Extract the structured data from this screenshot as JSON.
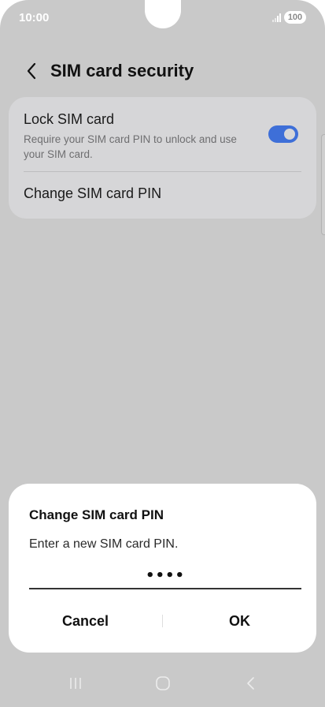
{
  "status_bar": {
    "time": "10:00",
    "battery": "100"
  },
  "header": {
    "title": "SIM card security",
    "back_icon": "chevron-left-icon"
  },
  "settings": {
    "lock_sim": {
      "title": "Lock SIM card",
      "description": "Require your SIM card PIN to unlock and use your SIM card.",
      "toggle_on": true
    },
    "change_pin": {
      "label": "Change SIM card PIN"
    }
  },
  "dialog": {
    "title": "Change SIM card PIN",
    "message": "Enter a new SIM card PIN.",
    "pin_value": "••••",
    "cancel_label": "Cancel",
    "ok_label": "OK"
  },
  "nav_bar": {
    "recents_icon": "recents-icon",
    "home_icon": "home-icon",
    "back_icon": "back-nav-icon"
  },
  "colors": {
    "scrim": "#c9c9c9",
    "card": "#d6d6d8",
    "accent": "#3e6fd8",
    "dialog": "#ffffff"
  }
}
